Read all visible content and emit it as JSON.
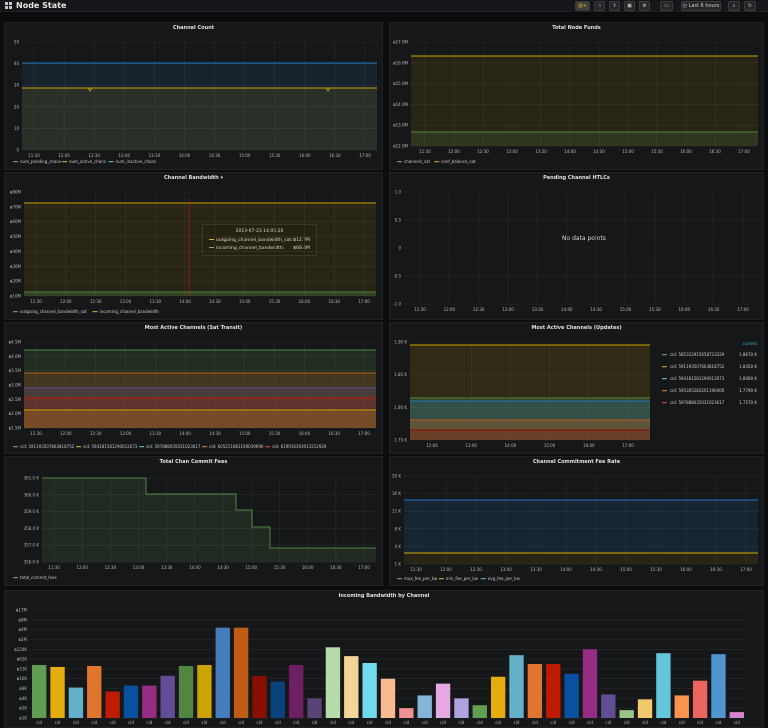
{
  "header": {
    "title": "Node State",
    "time_range": "Last 6 hours",
    "add_panel_icon": "add-panel-icon",
    "buttons": [
      "star-icon",
      "share-icon",
      "save-icon",
      "settings-icon",
      "tv-mode-icon",
      "zoom-out-icon",
      "refresh-icon"
    ]
  },
  "time_ticks": [
    "11:30",
    "12:00",
    "12:30",
    "13:00",
    "13:30",
    "14:00",
    "14:30",
    "15:00",
    "15:30",
    "16:00",
    "16:30",
    "17:00"
  ],
  "time_ticks_short": [
    "12:00",
    "13:00",
    "14:00",
    "15:00",
    "16:00",
    "17:00"
  ],
  "panels": {
    "channel_count": {
      "title": "Channel Count",
      "yticks": [
        "50",
        "40",
        "30",
        "20",
        "10",
        "0"
      ],
      "legend": [
        "num_pending_chans",
        "num_active_chans",
        "num_inactive_chans"
      ]
    },
    "total_node_funds": {
      "title": "Total Node Funds",
      "yticks": [
        "฿17.0M",
        "฿16.0M",
        "฿15.0M",
        "฿14.0M",
        "฿13.0M",
        "฿12.0M"
      ],
      "legend": [
        "channels_sat",
        "conf_balance_sat"
      ]
    },
    "channel_bandwidth": {
      "title": "Channel Bandwidth",
      "yticks": [
        "฿80M",
        "฿70M",
        "฿60M",
        "฿50M",
        "฿40M",
        "฿30M",
        "฿20M",
        "฿10M"
      ],
      "legend": [
        "outgoing_channel_bandwidth_sat",
        "incoming_channel_bandwidth"
      ],
      "tooltip": {
        "time": "2019-07-23 14:05:20",
        "rows": [
          {
            "label": "outgoing_channel_bandwidth_sat:",
            "value": "฿12.7M"
          },
          {
            "label": "incoming_channel_bandwidth:",
            "value": "฿68.4M"
          }
        ]
      }
    },
    "pending_htlcs": {
      "title": "Pending Channel HTLCs",
      "no_data": "No data points",
      "yticks": [
        "1.0",
        "0.5",
        "0",
        "-0.5",
        "-1.0"
      ]
    },
    "active_sat": {
      "title": "Most Active Channels (Sat Transit)",
      "yticks": [
        "฿4.5M",
        "฿4.0M",
        "฿3.5M",
        "฿3.0M",
        "฿2.5M",
        "฿2.0M",
        "฿1.5M"
      ],
      "legend": [
        "cid: 591193507663818752",
        "cid: 594181581290012673",
        "cid: 597888035031023617",
        "cid: 605211981190039696",
        "cid: 619916393913212929"
      ]
    },
    "active_updates": {
      "title": "Most Active Channels (Updates)",
      "yticks": [
        "1.90 K",
        "1.85 K",
        "1.80 K",
        "1.75 K"
      ],
      "legend_header": "current",
      "legend": [
        {
          "label": "cid: 585322915658723329",
          "value": "1.8670 K"
        },
        {
          "label": "cid: 591193507663818752",
          "value": "1.8450 K"
        },
        {
          "label": "cid: 594181581290012673",
          "value": "1.8060 K"
        },
        {
          "label": "cid: 595305282201190400",
          "value": "1.7790 K"
        },
        {
          "label": "cid: 597888035031023617",
          "value": "1.7570 K"
        }
      ]
    },
    "commit_fees": {
      "title": "Total Chan Commit Fees",
      "yticks": [
        "361.0 K",
        "360.0 K",
        "359.0 K",
        "358.0 K",
        "357.0 K",
        "356.0 K"
      ],
      "legend": [
        "total_commit_fees"
      ]
    },
    "fee_rate": {
      "title": "Channel Commitment Fee Rate",
      "yticks": [
        "20 K",
        "16 K",
        "12 K",
        "8 K",
        "4 K",
        "1 K"
      ],
      "legend": [
        "max_fee_per_kw",
        "min_fee_per_kw",
        "avg_fee_per_kw"
      ]
    },
    "incoming_bw": {
      "title": "Incoming Bandwidth by Channel",
      "yticks": [
        "฿17M",
        "฿9M",
        "฿4M",
        "฿2M",
        "฿124K",
        "฿62K",
        "฿31K",
        "฿16K",
        "฿8K",
        "฿4K",
        "฿2K",
        "฿1K"
      ],
      "bar_label": "cid",
      "chart_data": {
        "type": "bar",
        "title": "Incoming Bandwidth by Channel",
        "categories": [
          "cid",
          "cid",
          "cid",
          "cid",
          "cid",
          "cid",
          "cid",
          "cid",
          "cid",
          "cid",
          "cid",
          "cid",
          "cid",
          "cid",
          "cid",
          "cid",
          "cid",
          "cid",
          "cid",
          "cid",
          "cid",
          "cid",
          "cid",
          "cid",
          "cid",
          "cid",
          "cid",
          "cid",
          "cid",
          "cid",
          "cid",
          "cid",
          "cid",
          "cid",
          "cid",
          "cid",
          "cid",
          "cid"
        ],
        "level_index": [
          5.4,
          5.2,
          3.1,
          5.3,
          2.7,
          3.3,
          3.3,
          4.3,
          5.3,
          5.4,
          9.2,
          9.2,
          4.3,
          3.7,
          5.4,
          2.0,
          7.2,
          6.3,
          5.6,
          4.0,
          1.0,
          2.3,
          3.5,
          2.0,
          1.3,
          4.2,
          6.4,
          5.5,
          5.5,
          4.5,
          7.0,
          2.4,
          0.8,
          1.9,
          6.6,
          2.3,
          3.8,
          6.5,
          0.6
        ],
        "colors": [
          "#629e51",
          "#e5ac0e",
          "#64b0c8",
          "#e0752d",
          "#bf1b00",
          "#0a50a1",
          "#962d82",
          "#614d93",
          "#508642",
          "#cca300",
          "#447ebc",
          "#c15c17",
          "#890f02",
          "#0a437c",
          "#6d1f62",
          "#584477",
          "#b7dbab",
          "#f4d598",
          "#70dbed",
          "#f9ba8f",
          "#f29191",
          "#82b5d8",
          "#e5a8e2",
          "#aea2e0",
          "#629e51",
          "#e5ac0e",
          "#64b0c8",
          "#e0752d",
          "#bf1b00",
          "#0a50a1",
          "#962d82",
          "#614d93",
          "#9ac48a",
          "#f2c96d",
          "#65c5db",
          "#f9934e",
          "#ea6460",
          "#5195ce",
          "#d683ce"
        ]
      }
    }
  }
}
